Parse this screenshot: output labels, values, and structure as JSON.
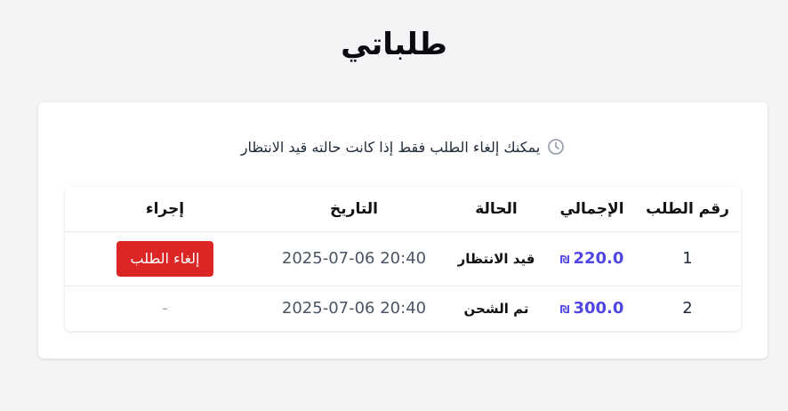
{
  "page": {
    "title": "طلباتي"
  },
  "notice": {
    "icon": "clock-icon",
    "text": "يمكنك إلغاء الطلب فقط إذا كانت حالته قيد الانتظار"
  },
  "table": {
    "headers": {
      "order_id": "رقم الطلب",
      "total": "الإجمالي",
      "status": "الحالة",
      "date": "التاريخ",
      "action": "إجراء"
    },
    "rows": [
      {
        "order_id": "1",
        "total": "220.0",
        "currency": "₪",
        "status": "قيد الانتظار",
        "date": "2025-07-06 20:40",
        "action_label": "إلغاء الطلب"
      },
      {
        "order_id": "2",
        "total": "300.0",
        "currency": "₪",
        "status": "تم الشحن",
        "date": "2025-07-06 20:40",
        "action_label": "-"
      }
    ]
  },
  "colors": {
    "accent_total": "#4f46e5",
    "cancel_button": "#dc2626",
    "background": "#f3f4f6"
  }
}
